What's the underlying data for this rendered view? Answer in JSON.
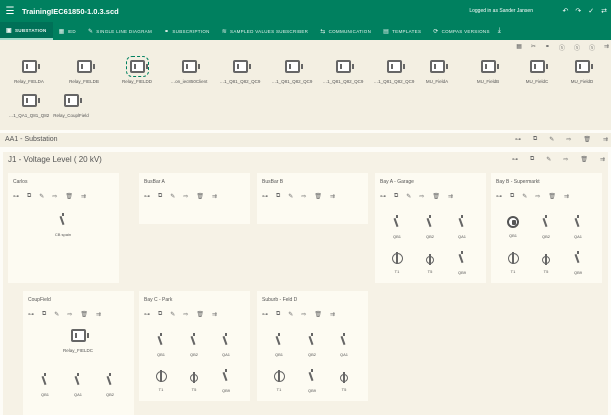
{
  "app": {
    "title": "TrainingIEC61850-1.0.3.scd",
    "login": "Logged in as Sander Jansen"
  },
  "tabs": [
    {
      "label": "SUBSTATION",
      "icon": "substation-icon"
    },
    {
      "label": "IED",
      "icon": "ied-icon"
    },
    {
      "label": "SINGLE LINE DIAGRAM",
      "icon": "edit-icon"
    },
    {
      "label": "SUBSCRIPTION",
      "icon": "link-icon"
    },
    {
      "label": "SAMPLED VALUES SUBSCRIBER",
      "icon": "subscriber-icon"
    },
    {
      "label": "COMMUNICATION",
      "icon": "communication-icon"
    },
    {
      "label": "TEMPLATES",
      "icon": "templates-icon"
    },
    {
      "label": "COMPAS VERSIONS",
      "icon": "versions-icon"
    }
  ],
  "ieds": [
    "Relay_FIELDA",
    "Relay_FIELDB",
    "Relay_FIELDD",
    "…on_iec850Client",
    "…1_Q81_Q82_QC9",
    "…1_Q81_Q82_QC9",
    "…1_Q81_Q82_QC9",
    "…1_Q81_Q82_QC9",
    "MU_FieldA",
    "MU_FieldB",
    "MU_FieldC",
    "MU_FieldD",
    "…1_QA1_Q81_Q82",
    "Relay_CouplField"
  ],
  "substation": {
    "title": "AA1 - Substation"
  },
  "voltage_level": {
    "title": "J1 - Voltage Level ( 20 kV)"
  },
  "bays": [
    {
      "title": "Carlos",
      "equipment": [
        {
          "name": "CB spain",
          "type": "switch"
        }
      ]
    },
    {
      "title": "BusBar A",
      "equipment": []
    },
    {
      "title": "BusBar B",
      "equipment": []
    },
    {
      "title": "Bay A - Garage",
      "equipment": [
        {
          "name": "QB1",
          "type": "switch"
        },
        {
          "name": "QB2",
          "type": "switch"
        },
        {
          "name": "QA1",
          "type": "switch"
        },
        {
          "name": "T1",
          "type": "transformer"
        },
        {
          "name": "T5",
          "type": "ct"
        },
        {
          "name": "QB9",
          "type": "switch"
        }
      ]
    },
    {
      "title": "Bay B - Supermarkt",
      "equipment": [
        {
          "name": "QB1",
          "type": "disconnector"
        },
        {
          "name": "QB2",
          "type": "switch"
        },
        {
          "name": "QA1",
          "type": "switch"
        },
        {
          "name": "T1",
          "type": "transformer"
        },
        {
          "name": "T5",
          "type": "ct"
        },
        {
          "name": "QB9",
          "type": "switch"
        }
      ]
    },
    {
      "title": "CoupField",
      "ied": "Relay_FIELDC",
      "equipment": [
        {
          "name": "QB1",
          "type": "switch"
        },
        {
          "name": "QA1",
          "type": "switch"
        },
        {
          "name": "QB2",
          "type": "switch"
        }
      ]
    },
    {
      "title": "Bay C - Park",
      "equipment": [
        {
          "name": "QB1",
          "type": "switch"
        },
        {
          "name": "QB2",
          "type": "switch"
        },
        {
          "name": "QA1",
          "type": "switch"
        },
        {
          "name": "T1",
          "type": "transformer"
        },
        {
          "name": "T5",
          "type": "ct"
        },
        {
          "name": "QB9",
          "type": "switch"
        }
      ]
    },
    {
      "title": "Suburb - Feld D",
      "equipment": [
        {
          "name": "QB1",
          "type": "switch"
        },
        {
          "name": "QB2",
          "type": "switch"
        },
        {
          "name": "QA1",
          "type": "switch"
        },
        {
          "name": "T1",
          "type": "transformer"
        },
        {
          "name": "QB9",
          "type": "switch"
        },
        {
          "name": "T5",
          "type": "ct"
        }
      ]
    }
  ],
  "colors": {
    "primary": "#00805f",
    "background": "#fdfcf7",
    "panel": "#f3efe2"
  }
}
